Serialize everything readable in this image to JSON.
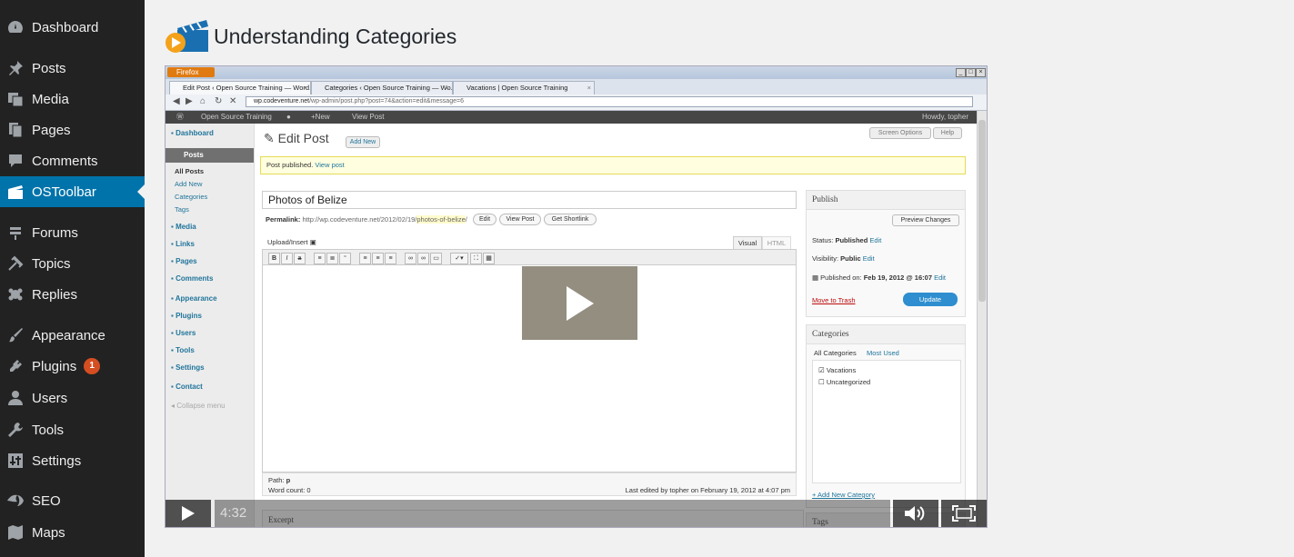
{
  "sidebar": {
    "items": [
      {
        "label": "Dashboard",
        "icon": "dashboard-icon"
      },
      {
        "label": "Posts",
        "icon": "pin-icon"
      },
      {
        "label": "Media",
        "icon": "media-icon"
      },
      {
        "label": "Pages",
        "icon": "pages-icon"
      },
      {
        "label": "Comments",
        "icon": "comments-icon"
      },
      {
        "label": "OSToolbar",
        "icon": "clapperboard-icon"
      },
      {
        "label": "Forums",
        "icon": "forums-icon"
      },
      {
        "label": "Topics",
        "icon": "topics-icon"
      },
      {
        "label": "Replies",
        "icon": "replies-icon"
      },
      {
        "label": "Appearance",
        "icon": "brush-icon"
      },
      {
        "label": "Plugins",
        "icon": "plugin-icon",
        "badge": "1"
      },
      {
        "label": "Users",
        "icon": "user-icon"
      },
      {
        "label": "Tools",
        "icon": "wrench-icon"
      },
      {
        "label": "Settings",
        "icon": "settings-icon"
      },
      {
        "label": "SEO",
        "icon": "seo-icon"
      },
      {
        "label": "Maps",
        "icon": "map-icon"
      }
    ],
    "current": "OSToolbar",
    "accent": "#0073aa"
  },
  "page": {
    "title": "Understanding Categories"
  },
  "video": {
    "browser": {
      "app_button": "Firefox",
      "tabs": [
        "Edit Post ‹ Open Source Training — Word...",
        "Categories ‹ Open Source Training — Wo...",
        "Vacations | Open Source Training"
      ],
      "url_domain": "wp.codeventure.net",
      "url_path": "/wp-admin/post.php?post=74&action=edit&message=6"
    },
    "wp_adminbar": {
      "site": "Open Source Training",
      "new": "New",
      "view": "View Post",
      "howdy": "Howdy, topher"
    },
    "wp_menu": {
      "dashboard": "Dashboard",
      "posts": "Posts",
      "posts_sub": [
        "All Posts",
        "Add New",
        "Categories",
        "Tags"
      ],
      "items": [
        "Media",
        "Links",
        "Pages",
        "Comments"
      ],
      "items2": [
        "Appearance",
        "Plugins",
        "Users",
        "Tools",
        "Settings"
      ],
      "contact": "Contact",
      "collapse": "Collapse menu"
    },
    "editor": {
      "heading": "Edit Post",
      "add_new": "Add New",
      "screen_options": "Screen Options",
      "help": "Help",
      "notice": "Post published.",
      "notice_link": "View post",
      "post_title": "Photos of Belize",
      "permalink_label": "Permalink:",
      "permalink_base": "http://wp.codeventure.net/2012/02/19/",
      "permalink_slug": "photos-of-belize",
      "permalink_end": "/",
      "btn_edit": "Edit",
      "btn_view_post": "View Post",
      "btn_shortlink": "Get Shortlink",
      "upload_insert": "Upload/Insert",
      "tab_visual": "Visual",
      "tab_html": "HTML",
      "path": "Path:",
      "path_value": "p",
      "word_count": "Word count: 0",
      "last_edited": "Last edited by topher on February 19, 2012 at 4:07 pm",
      "excerpt": "Excerpt"
    },
    "publish": {
      "title": "Publish",
      "preview": "Preview Changes",
      "status_label": "Status:",
      "status_value": "Published",
      "visibility_label": "Visibility:",
      "visibility_value": "Public",
      "published_on_label": "Published on:",
      "published_on_value": "Feb 19, 2012 @ 16:07",
      "edit": "Edit",
      "trash": "Move to Trash",
      "update": "Update"
    },
    "categories": {
      "title": "Categories",
      "tab_all": "All Categories",
      "tab_used": "Most Used",
      "items": [
        {
          "label": "Vacations",
          "checked": true
        },
        {
          "label": "Uncategorized",
          "checked": false
        }
      ],
      "add_new": "+ Add New Category",
      "tags": "Tags"
    },
    "player": {
      "time": "4:32"
    }
  }
}
